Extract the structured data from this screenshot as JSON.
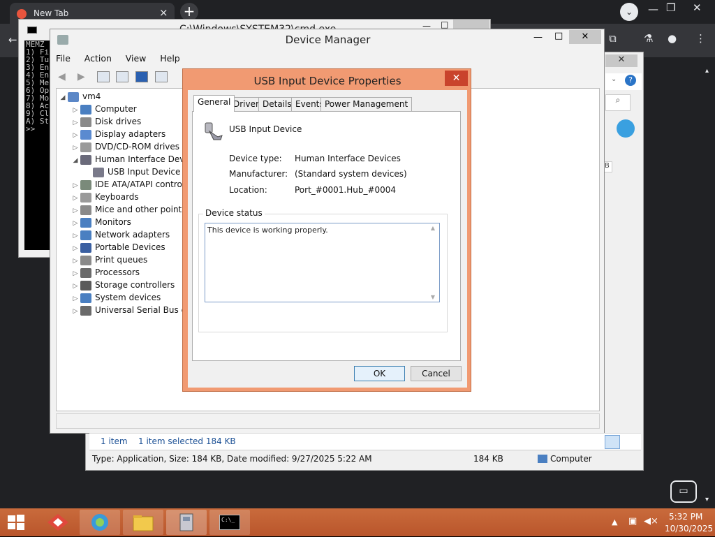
{
  "browser": {
    "tab_title": "New Tab",
    "tab_close": "×",
    "new_tab": "+",
    "controls": {
      "minimize": "—",
      "restore": "❐",
      "close": "✕"
    },
    "dropdown": "⌄"
  },
  "cmd": {
    "title": "C:\\Windows\\SYSTEM32\\cmd.exe",
    "lines": "MEMZ\n1) Fi\n2) Tu\n3) En\n4) En\n5) Me\n6) Op\n7) Mo\n8) Ac\n9) Cl\nA) St\n>>"
  },
  "device_manager": {
    "title": "Device Manager",
    "menu": [
      "File",
      "Action",
      "View",
      "Help"
    ],
    "tree": {
      "root": "vm4",
      "items": [
        {
          "label": "Computer",
          "arrow": "▷",
          "indent": 1,
          "color": "#4a7fc1"
        },
        {
          "label": "Disk drives",
          "arrow": "▷",
          "indent": 1,
          "color": "#8a8a8a"
        },
        {
          "label": "Display adapters",
          "arrow": "▷",
          "indent": 1,
          "color": "#5a8ad0"
        },
        {
          "label": "DVD/CD-ROM drives",
          "arrow": "▷",
          "indent": 1,
          "color": "#9a9a9a"
        },
        {
          "label": "Human Interface Devic",
          "arrow": "◢",
          "indent": 1,
          "color": "#6a6a7a"
        },
        {
          "label": "USB Input Device",
          "arrow": "",
          "indent": 2,
          "color": "#7a7a8a"
        },
        {
          "label": "IDE ATA/ATAPI contro",
          "arrow": "▷",
          "indent": 1,
          "color": "#7a8a7a"
        },
        {
          "label": "Keyboards",
          "arrow": "▷",
          "indent": 1,
          "color": "#9a9a9a"
        },
        {
          "label": "Mice and other pointin",
          "arrow": "▷",
          "indent": 1,
          "color": "#8a8a8a"
        },
        {
          "label": "Monitors",
          "arrow": "▷",
          "indent": 1,
          "color": "#4a7fc1"
        },
        {
          "label": "Network adapters",
          "arrow": "▷",
          "indent": 1,
          "color": "#4a7fc1"
        },
        {
          "label": "Portable Devices",
          "arrow": "▷",
          "indent": 1,
          "color": "#3a5fa1"
        },
        {
          "label": "Print queues",
          "arrow": "▷",
          "indent": 1,
          "color": "#8a8a8a"
        },
        {
          "label": "Processors",
          "arrow": "▷",
          "indent": 1,
          "color": "#6a6a6a"
        },
        {
          "label": "Storage controllers",
          "arrow": "▷",
          "indent": 1,
          "color": "#5a5a5a"
        },
        {
          "label": "System devices",
          "arrow": "▷",
          "indent": 1,
          "color": "#4a7fc1"
        },
        {
          "label": "Universal Serial Bus co",
          "arrow": "▷",
          "indent": 1,
          "color": "#6a6a6a"
        }
      ]
    }
  },
  "explorer": {
    "items_count": "1 item",
    "selected": "1 item selected  184 KB",
    "details": "Type: Application, Size: 184 KB, Date modified: 9/27/2025 5:22 AM",
    "size": "184 KB",
    "location": "Computer",
    "side_text": "B"
  },
  "properties": {
    "title": "USB Input Device Properties",
    "close": "✕",
    "tabs": [
      "General",
      "Driver",
      "Details",
      "Events",
      "Power Management"
    ],
    "device_name": "USB Input Device",
    "fields": [
      {
        "key": "Device type:",
        "value": "Human Interface Devices"
      },
      {
        "key": "Manufacturer:",
        "value": "(Standard system devices)"
      },
      {
        "key": "Location:",
        "value": "Port_#0001.Hub_#0004"
      }
    ],
    "status_legend": "Device status",
    "status_text": "This device is working properly.",
    "ok": "OK",
    "cancel": "Cancel"
  },
  "taskbar": {
    "time": "5:32 PM",
    "date": "10/30/2025",
    "cmd_icon_text": "C:\\_"
  }
}
